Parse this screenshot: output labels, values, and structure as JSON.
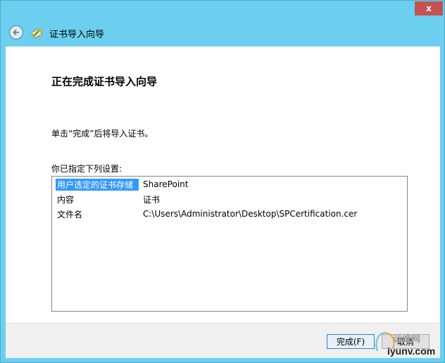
{
  "window": {
    "close_label": "x"
  },
  "header": {
    "title": "证书导入向导"
  },
  "main": {
    "heading": "正在完成证书导入向导",
    "instruction": "单击“完成”后将导入证书。",
    "settings_label": "你已指定下列设置:",
    "settings": [
      {
        "key": "用户选定的证书存储",
        "value": "SharePoint"
      },
      {
        "key": "内容",
        "value": "证书"
      },
      {
        "key": "文件名",
        "value": "C:\\Users\\Administrator\\Desktop\\SPCertification.cer"
      }
    ]
  },
  "footer": {
    "finish_label": "完成(F)",
    "cancel_label": "取消"
  },
  "watermark": {
    "brand": "运维网",
    "url": "iyunv.com"
  },
  "colors": {
    "accent": "#6ccff0",
    "selection": "#3399ff",
    "close": "#c75050"
  },
  "icons": {
    "back": "back-arrow-icon",
    "wizard": "certificate-icon"
  }
}
